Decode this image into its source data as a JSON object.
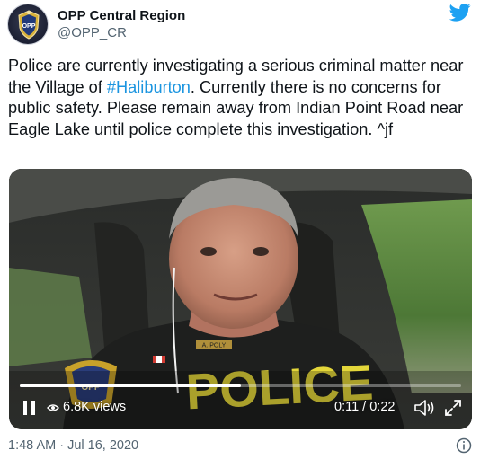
{
  "account": {
    "display_name": "OPP Central Region",
    "handle": "@OPP_CR",
    "avatar_text": "OPP",
    "avatar_icon": "police-crest-icon"
  },
  "brand": {
    "icon": "twitter-bird-icon",
    "color": "#1da1f2"
  },
  "tweet": {
    "text_before": "Police are currently investigating a serious criminal matter near the Village of ",
    "hashtag": "#Haliburton",
    "text_after": ". Currently there is no concerns for public safety. Please remain away from Indian Point Road near Eagle Lake until police complete this investigation. ^jf",
    "hashtag_color": "#1b95e0"
  },
  "video": {
    "views": "6.8K views",
    "time": "0:11 / 0:22",
    "progress": 0.5,
    "shirt_text": "POLICE",
    "badge_text": "OPP",
    "name_tag": "A. POLY",
    "icons": {
      "pause": "pause-icon",
      "views": "eye-icon",
      "volume": "volume-icon",
      "fullscreen": "fullscreen-icon"
    }
  },
  "footer": {
    "timestamp": "1:48 AM · Jul 16, 2020",
    "info_icon": "info-icon"
  }
}
